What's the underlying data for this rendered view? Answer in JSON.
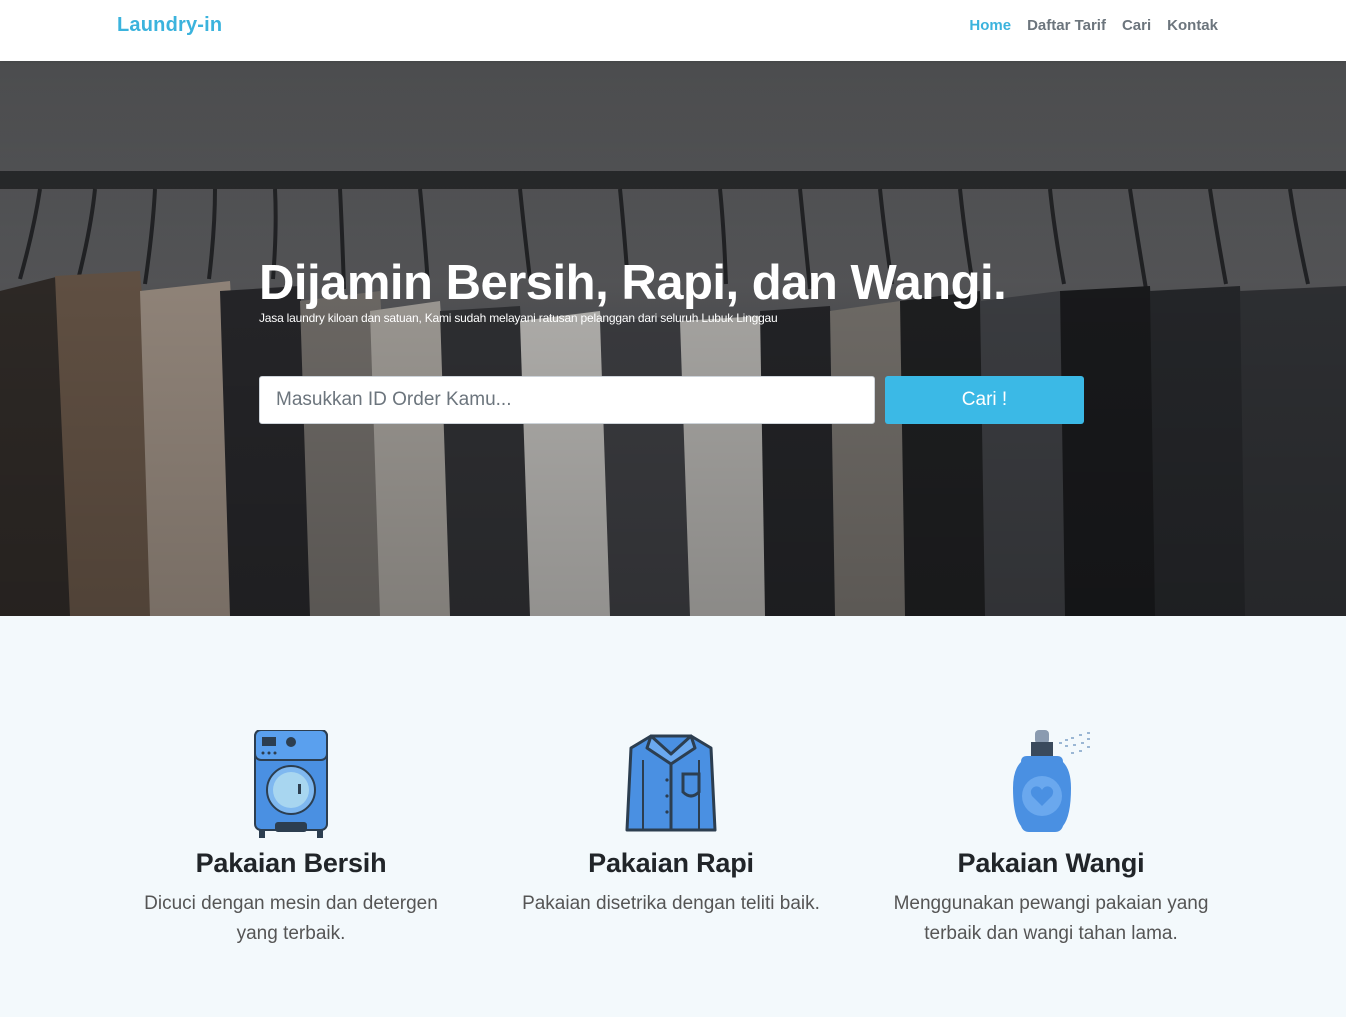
{
  "navbar": {
    "brand": "Laundry-in",
    "links": [
      {
        "label": "Home",
        "active": true
      },
      {
        "label": "Daftar Tarif",
        "active": false
      },
      {
        "label": "Cari",
        "active": false
      },
      {
        "label": "Kontak",
        "active": false
      }
    ]
  },
  "hero": {
    "title": "Dijamin Bersih, Rapi, dan Wangi.",
    "subtitle": "Jasa laundry kiloan dan satuan, Kami sudah melayani ratusan pelanggan dari seluruh Lubuk Linggau",
    "search_placeholder": "Masukkan ID Order Kamu...",
    "search_button": "Cari !"
  },
  "features": [
    {
      "icon": "washing-machine-icon",
      "title": "Pakaian Bersih",
      "text": "Dicuci dengan mesin dan detergen yang terbaik."
    },
    {
      "icon": "shirt-icon",
      "title": "Pakaian Rapi",
      "text": "Pakaian disetrika dengan teliti baik."
    },
    {
      "icon": "perfume-bottle-icon",
      "title": "Pakaian Wangi",
      "text": "Menggunakan pewangi pakaian yang terbaik dan wangi tahan lama."
    }
  ],
  "colors": {
    "accent": "#3bb3dd",
    "button": "#3bb9e6",
    "features_bg": "#f3f9fc",
    "icon_blue": "#4a90e2"
  }
}
